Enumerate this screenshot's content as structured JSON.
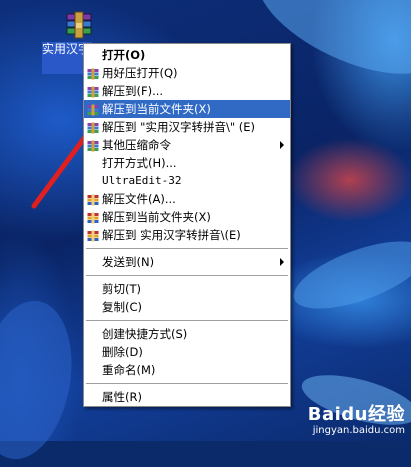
{
  "desktop": {
    "icon": {
      "name": "winrar-archive-icon",
      "label": "实用汉字转拼音."
    }
  },
  "context_menu": {
    "items": [
      {
        "type": "item",
        "label": "打开(O)",
        "icon": null,
        "bold": true,
        "highlighted": false,
        "submenu": false
      },
      {
        "type": "item",
        "label": "用好压打开(Q)",
        "icon": "winrar-icon",
        "bold": false,
        "highlighted": false,
        "submenu": false
      },
      {
        "type": "item",
        "label": "解压到(F)...",
        "icon": "winrar-icon",
        "bold": false,
        "highlighted": false,
        "submenu": false
      },
      {
        "type": "item",
        "label": "解压到当前文件夹(X)",
        "icon": "winrar-icon",
        "bold": false,
        "highlighted": true,
        "submenu": false
      },
      {
        "type": "item",
        "label": "解压到 \"实用汉字转拼音\\\" (E)",
        "icon": "winrar-icon",
        "bold": false,
        "highlighted": false,
        "submenu": false
      },
      {
        "type": "item",
        "label": "其他压缩命令",
        "icon": "winrar-icon",
        "bold": false,
        "highlighted": false,
        "submenu": true
      },
      {
        "type": "item",
        "label": "打开方式(H)...",
        "icon": null,
        "bold": false,
        "highlighted": false,
        "submenu": false
      },
      {
        "type": "item",
        "label": "UltraEdit-32",
        "icon": null,
        "bold": false,
        "highlighted": false,
        "submenu": false,
        "mono": true
      },
      {
        "type": "item",
        "label": "解压文件(A)...",
        "icon": "winrar-books-icon",
        "bold": false,
        "highlighted": false,
        "submenu": false
      },
      {
        "type": "item",
        "label": "解压到当前文件夹(X)",
        "icon": "winrar-books-icon",
        "bold": false,
        "highlighted": false,
        "submenu": false
      },
      {
        "type": "item",
        "label": "解压到 实用汉字转拼音\\(E)",
        "icon": "winrar-books-icon",
        "bold": false,
        "highlighted": false,
        "submenu": false
      },
      {
        "type": "separator"
      },
      {
        "type": "item",
        "label": "发送到(N)",
        "icon": null,
        "bold": false,
        "highlighted": false,
        "submenu": true
      },
      {
        "type": "separator"
      },
      {
        "type": "item",
        "label": "剪切(T)",
        "icon": null,
        "bold": false,
        "highlighted": false,
        "submenu": false
      },
      {
        "type": "item",
        "label": "复制(C)",
        "icon": null,
        "bold": false,
        "highlighted": false,
        "submenu": false
      },
      {
        "type": "separator"
      },
      {
        "type": "item",
        "label": "创建快捷方式(S)",
        "icon": null,
        "bold": false,
        "highlighted": false,
        "submenu": false
      },
      {
        "type": "item",
        "label": "删除(D)",
        "icon": null,
        "bold": false,
        "highlighted": false,
        "submenu": false
      },
      {
        "type": "item",
        "label": "重命名(M)",
        "icon": null,
        "bold": false,
        "highlighted": false,
        "submenu": false
      },
      {
        "type": "separator"
      },
      {
        "type": "item",
        "label": "属性(R)",
        "icon": null,
        "bold": false,
        "highlighted": false,
        "submenu": false
      }
    ]
  },
  "watermark": {
    "logo": "Baidu经验",
    "url": "jingyan.baidu.com"
  },
  "colors": {
    "highlight": "#316ac5",
    "annotation_arrow": "#e02020",
    "desktop_bg": "#0a2a6a"
  }
}
